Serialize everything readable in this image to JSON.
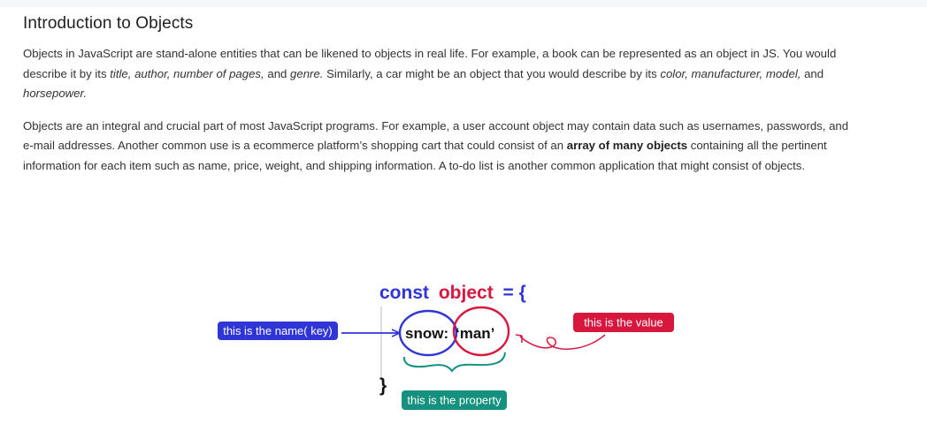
{
  "article": {
    "title": "Introduction to Objects",
    "p1": {
      "t1": "Objects in JavaScript are stand-alone entities that can be likened to objects in real life. For example, a book can be represented as an object in JS. You would describe it by its ",
      "e1": "title, author, number of pages,",
      "t2": " and ",
      "e2": "genre.",
      "t3": " Similarly, a car might be an object that you would describe by its ",
      "e3": "color, manufacturer, model,",
      "t4": " and ",
      "e4": "horsepower."
    },
    "p2": {
      "t1": "Objects are an integral and crucial part of most JavaScript programs. For example, a user account object may contain data such as usernames, passwords, and e-mail addresses. Another common use is a ecommerce platform’s shopping cart that could consist of an ",
      "b1": "array of many objects",
      "t2": " containing all the pertinent information for each item such as name, price, weight, and shipping information. A to-do list is another common application that might consist of objects."
    }
  },
  "diagram": {
    "code_const": "const",
    "code_object": "object",
    "code_eq": "= {",
    "code_key": "snow:",
    "code_value": "‘man’",
    "code_close": "}",
    "label_key": "this is the name( key)",
    "label_value": "this is the value",
    "label_property": "this is the property",
    "colors": {
      "blue": "#2f35d6",
      "red": "#d8173f",
      "teal": "#17917f",
      "ink": "#111111"
    }
  }
}
